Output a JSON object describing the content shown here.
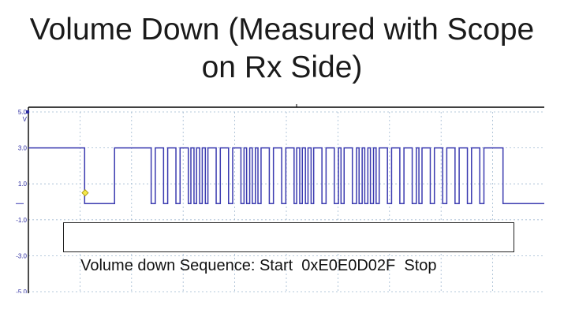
{
  "slide": {
    "title_line1": "Volume Down (Measured with Scope",
    "title_line2": "on Rx Side)",
    "caption": "Volume down Sequence: Start  0xE0E0D02F  Stop"
  },
  "colors": {
    "trace": "#3b3bb0",
    "grid": "#9fb8d0",
    "axis": "#000000",
    "marker": "#f4e84a",
    "tick_text": "#2a2aa0"
  },
  "chart_data": {
    "type": "line",
    "title": "",
    "xlabel": "",
    "ylabel": "V",
    "ylim": [
      -5.0,
      5.0
    ],
    "y_ticks": [
      "5.0",
      "3.0",
      "1.0",
      "-1.0",
      "-3.0",
      "-5.0"
    ],
    "grid": "on (dotted)",
    "x_units": "divisions",
    "xlim": [
      0,
      10
    ],
    "high_level_v": 3.0,
    "low_level_v": -0.1,
    "trigger_marker": {
      "t": 1.1,
      "v": 0.5
    },
    "series": [
      {
        "t": [
          0,
          1.09,
          1.09,
          1.67,
          1.67,
          2.38,
          2.38,
          2.46,
          2.46,
          2.62,
          2.62,
          2.7,
          2.7,
          2.86,
          2.86,
          2.94,
          2.94,
          3.1,
          3.1,
          3.15,
          3.15,
          3.21,
          3.21,
          3.26,
          3.26,
          3.32,
          3.32,
          3.37,
          3.37,
          3.43,
          3.43,
          3.48,
          3.48,
          3.64,
          3.64,
          3.72,
          3.72,
          3.88,
          3.88,
          3.96,
          3.96,
          4.12,
          4.12,
          4.18,
          4.18,
          4.23,
          4.23,
          4.29,
          4.29,
          4.34,
          4.34,
          4.4,
          4.4,
          4.45,
          4.45,
          4.51,
          4.51,
          4.67,
          4.67,
          4.75,
          4.75,
          4.91,
          4.91,
          4.99,
          4.99,
          5.15,
          5.15,
          5.2,
          5.2,
          5.26,
          5.26,
          5.31,
          5.31,
          5.37,
          5.37,
          5.42,
          5.42,
          5.48,
          5.48,
          5.53,
          5.53,
          5.69,
          5.69,
          5.77,
          5.77,
          5.93,
          5.93,
          6.01,
          6.01,
          6.06,
          6.06,
          6.12,
          6.12,
          6.28,
          6.28,
          6.36,
          6.36,
          6.41,
          6.41,
          6.47,
          6.47,
          6.52,
          6.52,
          6.58,
          6.58,
          6.63,
          6.63,
          6.69,
          6.69,
          6.74,
          6.74,
          6.8,
          6.8,
          6.96,
          6.96,
          7.04,
          7.04,
          7.2,
          7.2,
          7.28,
          7.28,
          7.44,
          7.44,
          7.52,
          7.52,
          7.57,
          7.57,
          7.63,
          7.63,
          7.79,
          7.79,
          7.87,
          7.87,
          8.03,
          8.03,
          8.11,
          8.11,
          8.27,
          8.27,
          8.35,
          8.35,
          8.51,
          8.51,
          8.59,
          8.59,
          8.75,
          8.75,
          8.83,
          8.83,
          9.2,
          9.2,
          10.0
        ],
        "v": [
          3.0,
          3.0,
          -0.1,
          -0.1,
          3.0,
          3.0,
          -0.1,
          -0.1,
          3.0,
          3.0,
          -0.1,
          -0.1,
          3.0,
          3.0,
          -0.1,
          -0.1,
          3.0,
          3.0,
          -0.1,
          -0.1,
          3.0,
          3.0,
          -0.1,
          -0.1,
          3.0,
          3.0,
          -0.1,
          -0.1,
          3.0,
          3.0,
          -0.1,
          -0.1,
          3.0,
          3.0,
          -0.1,
          -0.1,
          3.0,
          3.0,
          -0.1,
          -0.1,
          3.0,
          3.0,
          -0.1,
          -0.1,
          3.0,
          3.0,
          -0.1,
          -0.1,
          3.0,
          3.0,
          -0.1,
          -0.1,
          3.0,
          3.0,
          -0.1,
          -0.1,
          3.0,
          3.0,
          -0.1,
          -0.1,
          3.0,
          3.0,
          -0.1,
          -0.1,
          3.0,
          3.0,
          -0.1,
          -0.1,
          3.0,
          3.0,
          -0.1,
          -0.1,
          3.0,
          3.0,
          -0.1,
          -0.1,
          3.0,
          3.0,
          -0.1,
          -0.1,
          3.0,
          3.0,
          -0.1,
          -0.1,
          3.0,
          3.0,
          -0.1,
          -0.1,
          3.0,
          3.0,
          -0.1,
          -0.1,
          3.0,
          3.0,
          -0.1,
          -0.1,
          3.0,
          3.0,
          -0.1,
          -0.1,
          3.0,
          3.0,
          -0.1,
          -0.1,
          3.0,
          3.0,
          -0.1,
          -0.1,
          3.0,
          3.0,
          -0.1,
          -0.1,
          3.0,
          3.0,
          -0.1,
          -0.1,
          3.0,
          3.0,
          -0.1,
          -0.1,
          3.0,
          3.0,
          -0.1,
          -0.1,
          3.0,
          3.0,
          -0.1,
          -0.1,
          3.0,
          3.0,
          -0.1,
          -0.1,
          3.0,
          3.0,
          -0.1,
          -0.1,
          3.0,
          3.0,
          -0.1,
          -0.1,
          3.0,
          3.0,
          -0.1,
          -0.1,
          3.0,
          3.0,
          -0.1,
          -0.1,
          3.0,
          3.0,
          -0.1,
          -0.1,
          3.0,
          3.0
        ]
      }
    ]
  }
}
